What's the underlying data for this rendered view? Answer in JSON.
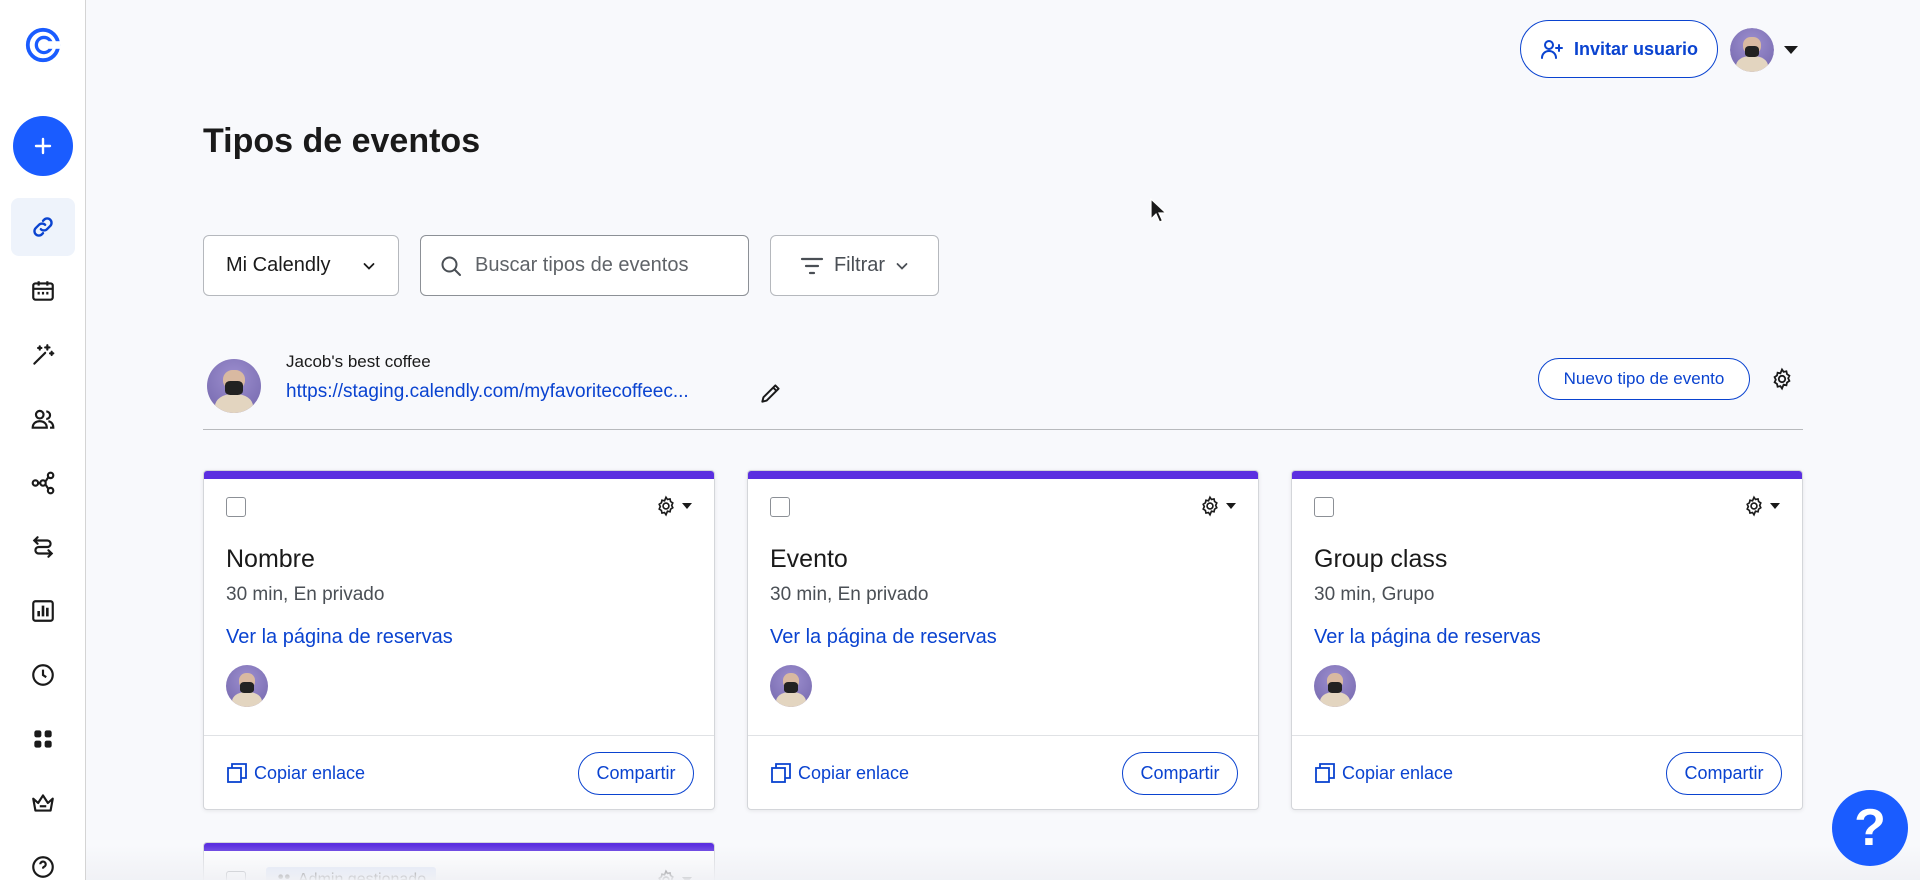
{
  "sidebar": {
    "logo": "calendly-logo-icon",
    "create": "plus-icon",
    "items": [
      {
        "name": "scheduling",
        "icon": "link-icon",
        "active": true
      },
      {
        "name": "meetings",
        "icon": "calendar-icon"
      },
      {
        "name": "ai",
        "icon": "magic-wand-icon"
      },
      {
        "name": "contacts",
        "icon": "people-icon"
      },
      {
        "name": "workflows",
        "icon": "workflow-icon"
      },
      {
        "name": "routing",
        "icon": "routing-icon"
      },
      {
        "name": "analytics",
        "icon": "chart-icon"
      },
      {
        "name": "availability",
        "icon": "clock-icon"
      },
      {
        "name": "integrations",
        "icon": "apps-icon"
      },
      {
        "name": "admin",
        "icon": "crown-icon"
      },
      {
        "name": "help",
        "icon": "help-circle-icon"
      }
    ]
  },
  "header": {
    "invite_label": "Invitar usuario"
  },
  "page": {
    "title": "Tipos de eventos"
  },
  "filters": {
    "dropdown_value": "Mi Calendly",
    "search_placeholder": "Buscar tipos de eventos",
    "filter_label": "Filtrar"
  },
  "owner": {
    "name": "Jacob's best coffee",
    "link": "https://staging.calendly.com/myfavoritecoffeec...",
    "new_type_label": "Nuevo tipo de evento"
  },
  "cards": [
    {
      "title": "Nombre",
      "subtitle": "30 min, En privado",
      "link": "Ver la página de reservas",
      "copy": "Copiar enlace",
      "share": "Compartir"
    },
    {
      "title": "Evento",
      "subtitle": "30 min, En privado",
      "link": "Ver la página de reservas",
      "copy": "Copiar enlace",
      "share": "Compartir"
    },
    {
      "title": "Group class",
      "subtitle": "30 min, Grupo",
      "link": "Ver la página de reservas",
      "copy": "Copiar enlace",
      "share": "Compartir"
    }
  ],
  "partial_card": {
    "badge": "Admin gestionado"
  },
  "help": {
    "label": "?"
  },
  "colors": {
    "accent": "#0a43d0",
    "primary": "#1a5cff",
    "card_bar": "#5b2fe0"
  }
}
